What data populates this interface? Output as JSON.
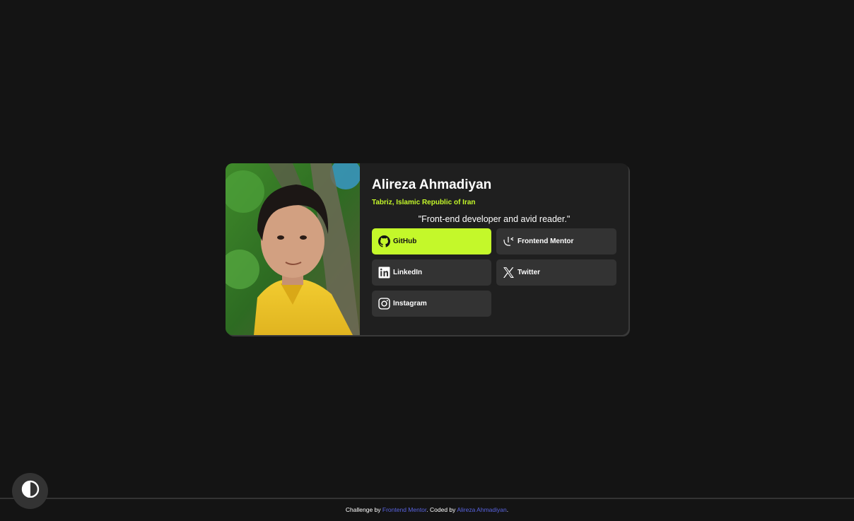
{
  "profile": {
    "name": "Alireza Ahmadiyan",
    "location": "Tabriz, Islamic Republic of Iran",
    "bio": "\"Front-end developer and avid reader.\"",
    "photo_alt": "Alireza Ahmadiyan"
  },
  "links": [
    {
      "label": "GitHub",
      "icon": "github-icon",
      "primary": true
    },
    {
      "label": "Frontend Mentor",
      "icon": "frontend-mentor-icon",
      "primary": false
    },
    {
      "label": "LinkedIn",
      "icon": "linkedin-icon",
      "primary": false
    },
    {
      "label": "Twitter",
      "icon": "x-twitter-icon",
      "primary": false
    },
    {
      "label": "Instagram",
      "icon": "instagram-icon",
      "primary": false
    }
  ],
  "theme_toggle": {
    "icon": "contrast-icon"
  },
  "footer": {
    "challenge_prefix": "Challenge by",
    "challenge_link": "Frontend Mentor",
    "coded_prefix": ". Coded by",
    "coded_link": "Alireza Ahmadiyan",
    "suffix": "."
  },
  "colors": {
    "background": "#141414",
    "card": "#1f1f1f",
    "accent": "#c4f82a",
    "button": "#333333",
    "link": "#5964e0"
  }
}
